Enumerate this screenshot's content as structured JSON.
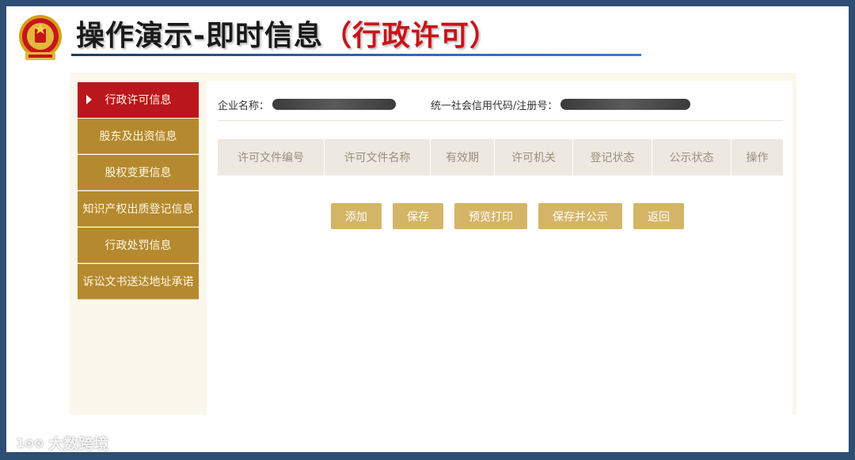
{
  "slide": {
    "title_main": "操作演示-即时信息",
    "title_accent": "（行政许可）"
  },
  "colors": {
    "active_nav": "#b9171d",
    "nav": "#b5892e",
    "button": "#d4b567",
    "accent_red": "#c8141a"
  },
  "sidebar": {
    "items": [
      {
        "label": "行政许可信息",
        "active": true
      },
      {
        "label": "股东及出资信息"
      },
      {
        "label": "股权变更信息"
      },
      {
        "label": "知识产权出质登记信息"
      },
      {
        "label": "行政处罚信息"
      },
      {
        "label": "诉讼文书送达地址承诺"
      }
    ]
  },
  "info": {
    "company_label": "企业名称：",
    "credit_code_label": "统一社会信用代码/注册号："
  },
  "table": {
    "columns": [
      "许可文件编号",
      "许可文件名称",
      "有效期",
      "许可机关",
      "登记状态",
      "公示状态",
      "操作"
    ]
  },
  "actions": {
    "add": "添加",
    "save": "保存",
    "preview_print": "预览打印",
    "save_publish": "保存并公示",
    "back": "返回"
  },
  "watermark": {
    "mark": "1⊙⊙",
    "text": "大数跨境"
  }
}
